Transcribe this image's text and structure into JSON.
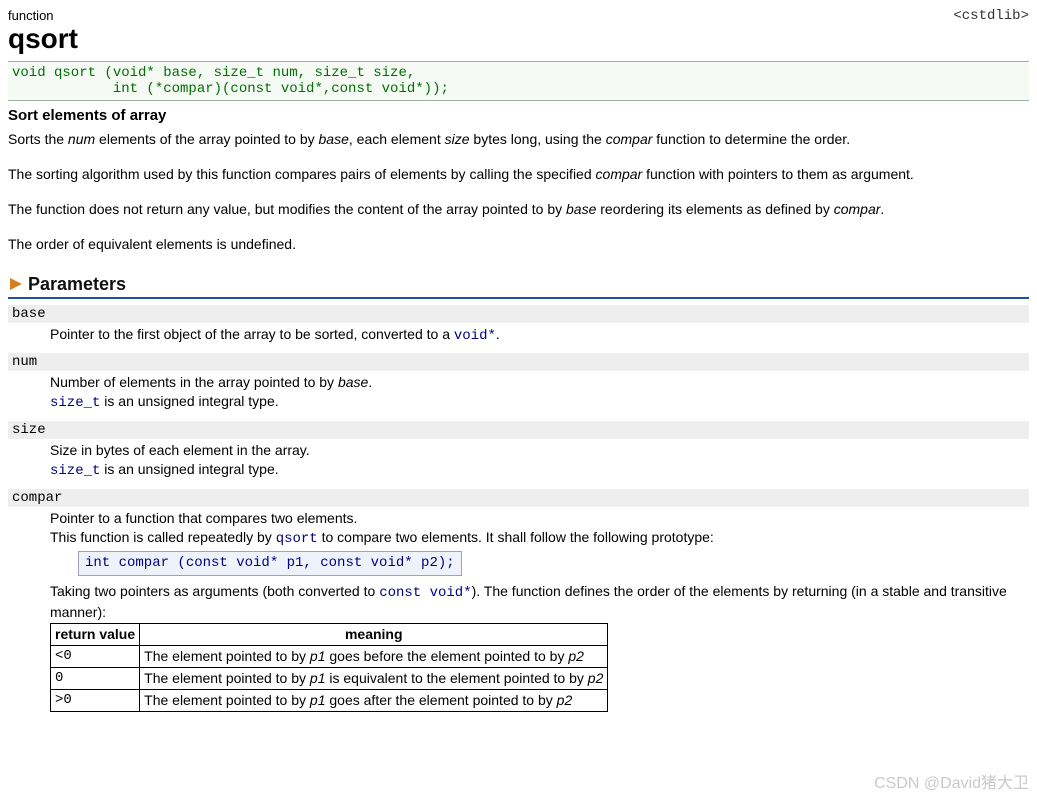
{
  "header": {
    "kind": "function",
    "name": "qsort",
    "include": "<cstdlib>"
  },
  "signature": "void qsort (void* base, size_t num, size_t size,\n            int (*compar)(const void*,const void*));",
  "summary": {
    "heading": "Sort elements of array",
    "p1_pre": "Sorts the ",
    "p1_num": "num",
    "p1_mid1": " elements of the array pointed to by ",
    "p1_base": "base",
    "p1_mid2": ", each element ",
    "p1_size": "size",
    "p1_mid3": " bytes long, using the ",
    "p1_compar": "compar",
    "p1_post": " function to determine the order.",
    "p2_pre": "The sorting algorithm used by this function compares pairs of elements by calling the specified ",
    "p2_compar": "compar",
    "p2_post": " function with pointers to them as argument.",
    "p3_pre": "The function does not return any value, but modifies the content of the array pointed to by ",
    "p3_base": "base",
    "p3_mid": " reordering its elements as defined by ",
    "p3_compar": "compar",
    "p3_post": ".",
    "p4": "The order of equivalent elements is undefined."
  },
  "sections": {
    "parameters_title": "Parameters"
  },
  "params": {
    "base": {
      "name": "base",
      "l1_pre": "Pointer to the first object of the array to be sorted, converted to a ",
      "l1_code": "void*",
      "l1_post": "."
    },
    "num": {
      "name": "num",
      "l1_pre": "Number of elements in the array pointed to by ",
      "l1_it": "base",
      "l1_post": ".",
      "l2_code": "size_t",
      "l2_post": " is an unsigned integral type."
    },
    "size": {
      "name": "size",
      "l1": "Size in bytes of each element in the array.",
      "l2_code": "size_t",
      "l2_post": " is an unsigned integral type."
    },
    "compar": {
      "name": "compar",
      "l1": "Pointer to a function that compares two elements.",
      "l2_pre": "This function is called repeatedly by ",
      "l2_code": "qsort",
      "l2_post": " to compare two elements. It shall follow the following prototype:",
      "proto": "int compar (const void* p1, const void* p2);",
      "l3_pre": "Taking two pointers as arguments (both converted to ",
      "l3_code": "const void*",
      "l3_post": "). The function defines the order of the elements by returning (in a stable and transitive manner):"
    }
  },
  "ret_table": {
    "h1": "return value",
    "h2": "meaning",
    "rows": [
      {
        "v": "<0",
        "m_pre": "The element pointed to by ",
        "m_p1": "p1",
        "m_mid": " goes before the element pointed to by ",
        "m_p2": "p2"
      },
      {
        "v": "0",
        "m_pre": "The element pointed to by ",
        "m_p1": "p1",
        "m_mid": " is equivalent to the element pointed to by ",
        "m_p2": "p2"
      },
      {
        "v": ">0",
        "m_pre": "The element pointed to by ",
        "m_p1": "p1",
        "m_mid": " goes after the element pointed to by ",
        "m_p2": "p2"
      }
    ]
  },
  "watermark": "CSDN @David猪大卫"
}
